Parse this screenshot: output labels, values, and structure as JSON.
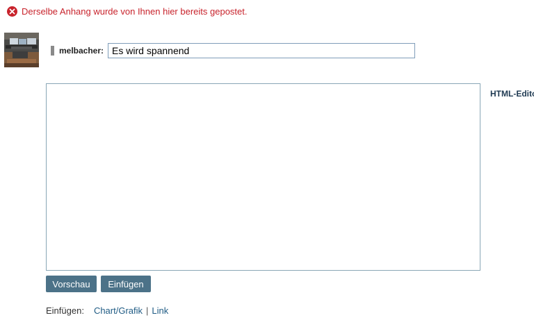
{
  "error": {
    "message": "Derselbe Anhang wurde von Ihnen hier bereits gepostet.",
    "icon": "error-circle-icon",
    "color": "#c8232c"
  },
  "post": {
    "username": "melbacher:",
    "title_value": "Es wird spannend",
    "editor_value": "",
    "html_editor_label": "HTML-Editor"
  },
  "buttons": {
    "preview_label": "Vorschau",
    "insert_label": "Einfügen",
    "color": "#4c7288"
  },
  "insert_links": {
    "label": "Einfügen:",
    "chart_label": "Chart/Grafik",
    "separator": "|",
    "link_label": "Link"
  }
}
